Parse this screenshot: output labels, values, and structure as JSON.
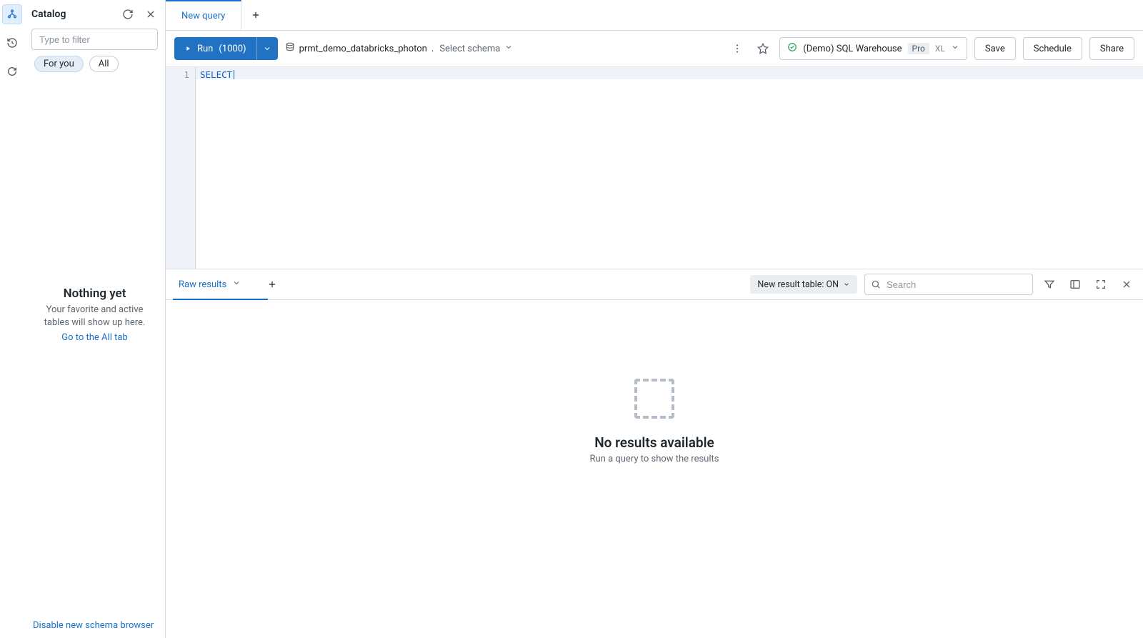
{
  "catalog": {
    "title": "Catalog",
    "filter_placeholder": "Type to filter",
    "pill_for_you": "For you",
    "pill_all": "All",
    "empty_title": "Nothing yet",
    "empty_body": "Your favorite and active tables will show up here.",
    "empty_link": "Go to the All tab",
    "disable_link": "Disable new schema browser"
  },
  "tabs": {
    "active_tab_label": "New query"
  },
  "toolbar": {
    "run_label": "Run",
    "run_count": "(1000)",
    "catalog_name": "prmt_demo_databricks_photon",
    "schema_hint": "Select schema",
    "warehouse_name": "(Demo) SQL Warehouse",
    "warehouse_badge": "Pro",
    "warehouse_size": "XL",
    "save_label": "Save",
    "schedule_label": "Schedule",
    "share_label": "Share"
  },
  "editor": {
    "line_number": "1",
    "line_content": "SELECT"
  },
  "results": {
    "tab_label": "Raw results",
    "toggle_label": "New result table: ON",
    "search_placeholder": "Search",
    "empty_title": "No results available",
    "empty_body": "Run a query to show the results"
  }
}
